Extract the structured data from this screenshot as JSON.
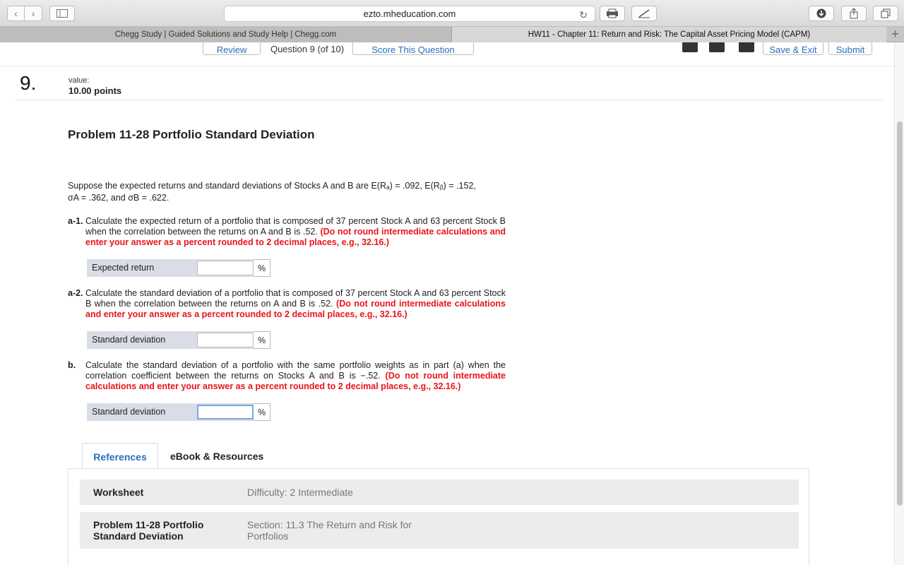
{
  "browser": {
    "url": "ezto.mheducation.com",
    "tabs": [
      {
        "title": "Chegg Study | Guided Solutions and Study Help | Chegg.com"
      },
      {
        "title": "HW11 - Chapter 11: Return and Risk: The Capital Asset Pricing Model (CAPM)"
      }
    ]
  },
  "topbar": {
    "review_label": "Review",
    "question_label": "Question 9 (of 10)",
    "score_label": "Score This Question",
    "save_exit_label": "Save & Exit",
    "submit_label": "Submit"
  },
  "question": {
    "number": "9.",
    "value_label": "value:",
    "points": "10.00 points",
    "title": "Problem 11-28 Portfolio Standard Deviation",
    "intro_line1": "Suppose the expected returns and standard deviations of Stocks A and B are E(Rₐ) = .092, E(Rᵦ) = .152,",
    "intro_line2": "σA = .362, and σB = .622.",
    "parts": [
      {
        "label": "a-1.",
        "text": "Calculate the expected return of a portfolio that is composed of 37 percent Stock A and 63 percent Stock B when the correlation between the returns on A and B is .52.",
        "instruction": "(Do not round intermediate calculations and enter your answer as a percent rounded to 2 decimal places, e.g., 32.16.)",
        "answer_label": "Expected return",
        "answer_value": "",
        "unit": "%"
      },
      {
        "label": "a-2.",
        "text": "Calculate the standard deviation of a portfolio that is composed of 37 percent Stock A and 63 percent Stock B when the correlation between the returns on A and B is .52.",
        "instruction": "(Do not round intermediate calculations and enter your answer as a percent rounded to 2 decimal places, e.g., 32.16.)",
        "answer_label": "Standard deviation",
        "answer_value": "",
        "unit": "%"
      },
      {
        "label": "b.",
        "text": "Calculate the standard deviation of a portfolio with the same portfolio weights as in part (a) when the correlation coefficient between the returns on Stocks A and B is −.52.",
        "instruction": "(Do not round intermediate calculations and enter your answer as a percent rounded to 2 decimal places, e.g., 32.16.)",
        "answer_label": "Standard deviation",
        "answer_value": "",
        "unit": "%"
      }
    ]
  },
  "references": {
    "tabs": [
      {
        "label": "References"
      },
      {
        "label": "eBook & Resources"
      }
    ],
    "rows": [
      {
        "name": "Worksheet",
        "value": "Difficulty: 2 Intermediate"
      },
      {
        "name": "Problem 11-28 Portfolio Standard Deviation",
        "value": "Section: 11.3 The Return and Risk for Portfolios"
      }
    ]
  }
}
